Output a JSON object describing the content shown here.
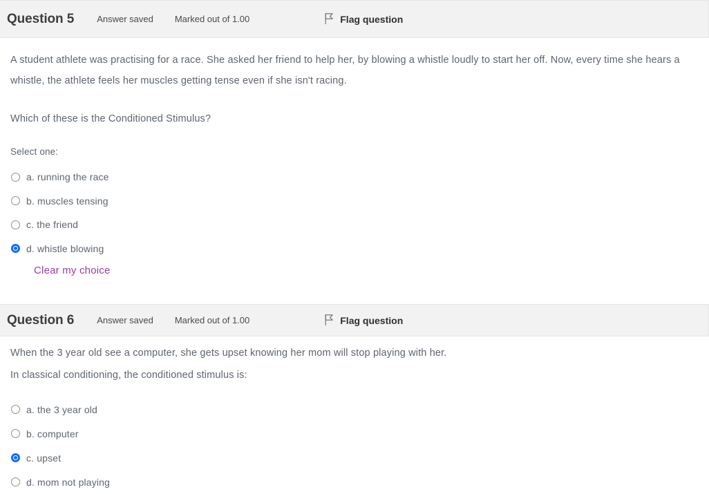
{
  "questions": [
    {
      "number_label": "Question 5",
      "state": "Answer saved",
      "grade": "Marked out of 1.00",
      "flag_label": "Flag question",
      "flag_icon": "flag-icon",
      "body_paragraphs": [
        "A student athlete was practising for a race. She asked her friend to help her, by blowing a whistle loudly to start her off.  Now, every time she hears a whistle, the athlete feels her muscles getting tense even if she isn't racing."
      ],
      "prompt": "Which of these is the Conditioned Stimulus?",
      "select_one_label": "Select one:",
      "options": [
        {
          "label": "a. running the race",
          "selected": false
        },
        {
          "label": "b. muscles tensing",
          "selected": false
        },
        {
          "label": "c. the friend",
          "selected": false
        },
        {
          "label": "d. whistle blowing",
          "selected": true
        }
      ],
      "clear_choice_label": "Clear my choice"
    },
    {
      "number_label": "Question 6",
      "state": "Answer saved",
      "grade": "Marked out of 1.00",
      "flag_label": "Flag question",
      "flag_icon": "flag-icon",
      "body_paragraphs": [
        "When the 3 year old see a computer, she gets upset knowing her mom will stop playing with her.",
        "In classical conditioning, the conditioned stimulus is:"
      ],
      "options": [
        {
          "label": "a. the 3 year old",
          "selected": false
        },
        {
          "label": "b. computer",
          "selected": false
        },
        {
          "label": "c. upset",
          "selected": true
        },
        {
          "label": "d. mom not playing",
          "selected": false
        }
      ]
    }
  ],
  "colors": {
    "header_background": "#f2f2f2",
    "header_border": "#e6e6e6",
    "body_text": "#5d6470",
    "heading_text": "#3d3d3d",
    "radio_selected": "#0d6efd",
    "link_purple": "#9b3ca0"
  }
}
